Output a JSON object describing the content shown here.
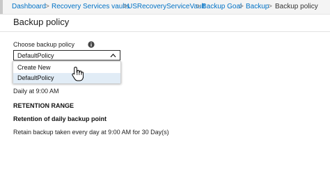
{
  "breadcrumb": {
    "items": [
      "Dashboard",
      "Recovery Services vaults",
      "USRecoveryServiceVault",
      "Backup Goal",
      "Backup",
      "Backup policy"
    ],
    "separator": ">"
  },
  "panel": {
    "title": "Backup policy",
    "field_label": "Choose backup policy",
    "info_icon": "info-icon"
  },
  "policy_select": {
    "selected": "DefaultPolicy",
    "options": [
      "Create New",
      "DefaultPolicy"
    ],
    "highlighted": "DefaultPolicy",
    "expanded": true
  },
  "policy_details": {
    "schedule": "Daily at 9:00 AM",
    "retention_heading": "RETENTION RANGE",
    "retention_subheading": "Retention of daily backup point",
    "retention_text": "Retain backup taken every day at 9:00 AM for 30 Day(s)"
  },
  "colors": {
    "link": "#0072c6",
    "highlight": "#e1ecf6",
    "breadcrumb_bg": "#f4f4f4"
  }
}
